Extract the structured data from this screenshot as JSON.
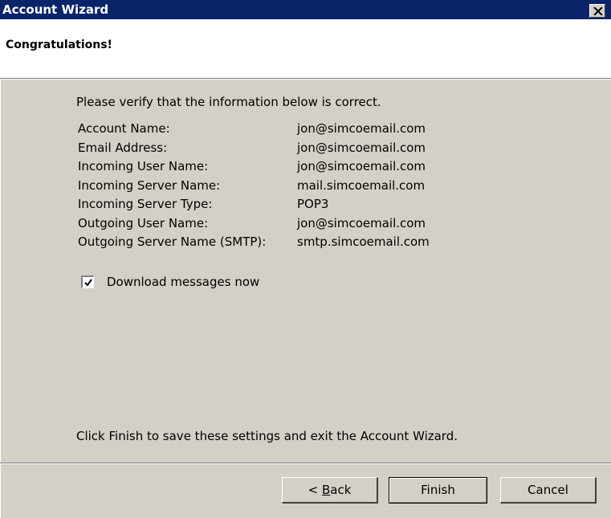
{
  "window": {
    "title": "Account Wizard",
    "close_icon": "close-icon"
  },
  "header": {
    "heading": "Congratulations!"
  },
  "main": {
    "intro": "Please verify that the information below is correct.",
    "rows": [
      {
        "label": "Account Name:",
        "value": "jon@simcoemail.com"
      },
      {
        "label": "Email Address:",
        "value": "jon@simcoemail.com"
      },
      {
        "label": "Incoming User Name:",
        "value": "jon@simcoemail.com"
      },
      {
        "label": "Incoming Server Name:",
        "value": "mail.simcoemail.com"
      },
      {
        "label": "Incoming Server Type:",
        "value": "POP3"
      },
      {
        "label": "Outgoing User Name:",
        "value": "jon@simcoemail.com"
      },
      {
        "label": "Outgoing Server Name (SMTP):",
        "value": "smtp.simcoemail.com"
      }
    ],
    "download_checkbox": {
      "label": "Download messages now",
      "checked": true
    },
    "footer_text": "Click Finish to save these settings and exit the Account Wizard."
  },
  "buttons": {
    "back_prefix": "< ",
    "back_mnemonic": "B",
    "back_rest": "ack",
    "finish": "Finish",
    "cancel": "Cancel"
  },
  "colors": {
    "titlebar": "#0a246a",
    "dialog_bg": "#d4d0c8",
    "header_bg": "#ffffff"
  }
}
